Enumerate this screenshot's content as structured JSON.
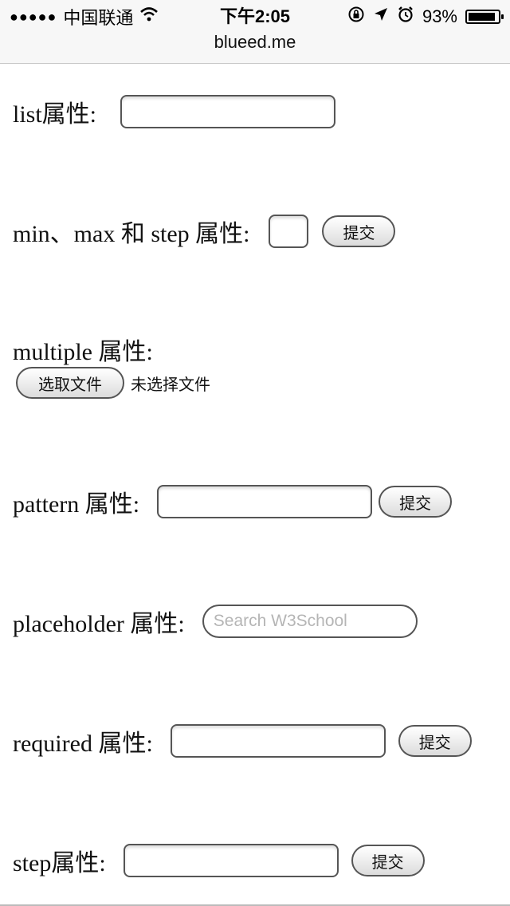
{
  "status_bar": {
    "signal": "●●●●●",
    "carrier": "中国联通",
    "time": "下午2:05",
    "battery_percent": "93%",
    "battery_level": 0.93,
    "icons": [
      "wifi-icon",
      "rotation-lock-icon",
      "location-arrow-icon",
      "alarm-icon",
      "battery-icon"
    ]
  },
  "browser": {
    "url": "blueed.me"
  },
  "form": {
    "list_label": "list属性:",
    "minmax_label": "min、max 和 step 属性:",
    "minmax_submit": "提交",
    "multiple_label": "multiple 属性:",
    "file_button": "选取文件",
    "file_status": "未选择文件",
    "pattern_label": "pattern 属性:",
    "pattern_submit": "提交",
    "placeholder_label": "placeholder 属性:",
    "placeholder_text": "Search W3School",
    "required_label": "required 属性:",
    "required_submit": "提交",
    "step_label": "step属性:",
    "step_submit": "提交"
  }
}
